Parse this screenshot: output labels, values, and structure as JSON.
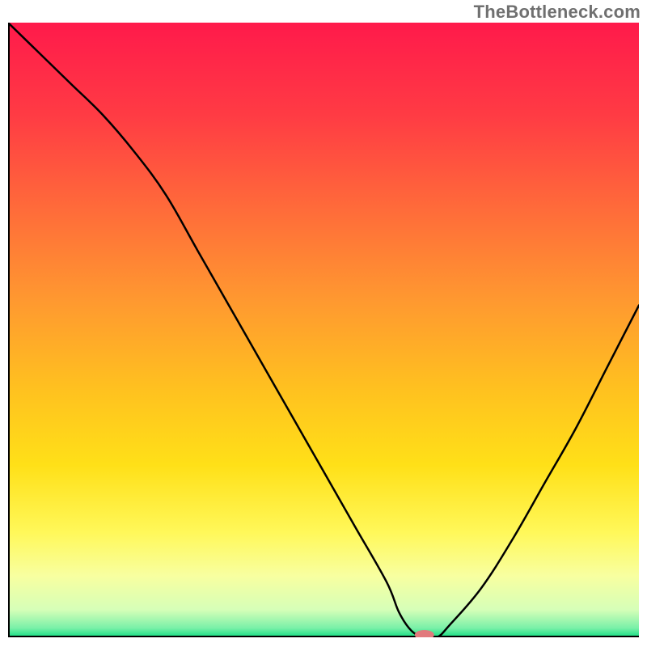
{
  "watermark": "TheBottleneck.com",
  "chart_data": {
    "type": "line",
    "title": "",
    "xlabel": "",
    "ylabel": "",
    "xlim": [
      0,
      100
    ],
    "ylim": [
      0,
      100
    ],
    "grid": false,
    "legend": false,
    "gradient_stops": [
      {
        "offset": 0.0,
        "color": "#ff1a4b"
      },
      {
        "offset": 0.15,
        "color": "#ff3b44"
      },
      {
        "offset": 0.3,
        "color": "#ff6a3a"
      },
      {
        "offset": 0.45,
        "color": "#ff9830"
      },
      {
        "offset": 0.6,
        "color": "#ffc21f"
      },
      {
        "offset": 0.72,
        "color": "#ffe018"
      },
      {
        "offset": 0.83,
        "color": "#fff85a"
      },
      {
        "offset": 0.9,
        "color": "#f8ffa0"
      },
      {
        "offset": 0.955,
        "color": "#d6ffb8"
      },
      {
        "offset": 0.985,
        "color": "#7af0a8"
      },
      {
        "offset": 1.0,
        "color": "#12dd82"
      }
    ],
    "series": [
      {
        "name": "bottleneck-curve",
        "x": [
          0,
          5,
          10,
          15,
          20,
          25,
          30,
          35,
          40,
          45,
          50,
          55,
          60,
          62,
          64,
          66,
          68,
          70,
          75,
          80,
          85,
          90,
          95,
          100
        ],
        "values": [
          100,
          95,
          90,
          85,
          79,
          72,
          63,
          54,
          45,
          36,
          27,
          18,
          9,
          4,
          1,
          0,
          0,
          2,
          8,
          16,
          25,
          34,
          44,
          54
        ]
      }
    ],
    "marker": {
      "x": 66,
      "y": 0,
      "color": "#e17a7d",
      "rx": 12,
      "ry": 6
    }
  }
}
